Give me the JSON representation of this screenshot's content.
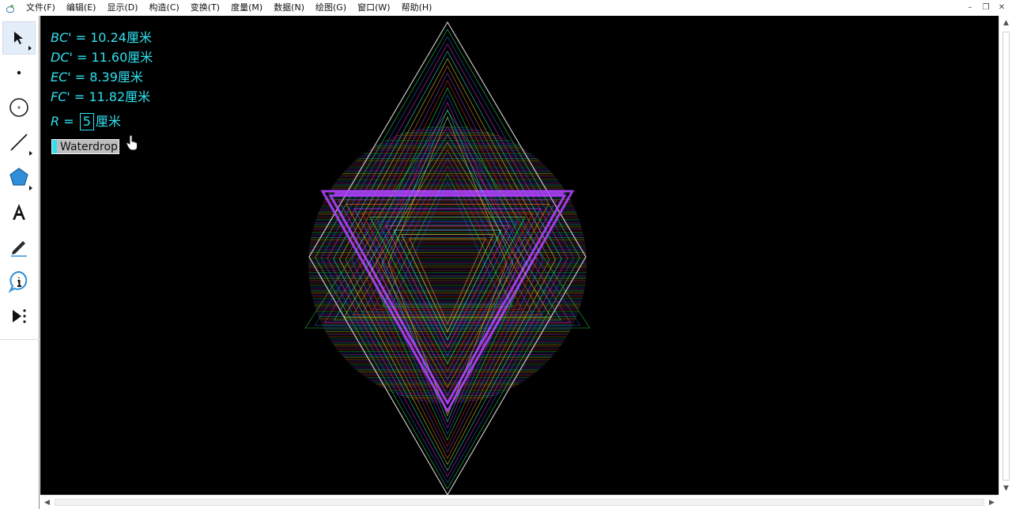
{
  "menu": {
    "items": [
      "文件(F)",
      "编辑(E)",
      "显示(D)",
      "构造(C)",
      "变换(T)",
      "度量(M)",
      "数据(N)",
      "绘图(G)",
      "窗口(W)",
      "帮助(H)"
    ]
  },
  "window_controls": {
    "minimize": "–",
    "restore": "❐",
    "close": "✕"
  },
  "toolbox": {
    "tools": [
      {
        "name": "arrow-select-tool",
        "glyph": "➤",
        "active": true
      },
      {
        "name": "point-tool",
        "glyph": "•"
      },
      {
        "name": "compass-tool",
        "glyph": "⊕"
      },
      {
        "name": "straightedge-tool",
        "glyph": "/"
      },
      {
        "name": "polygon-tool",
        "glyph": "⬟"
      },
      {
        "name": "text-tool",
        "glyph": "A"
      },
      {
        "name": "marker-tool",
        "glyph": "✎"
      },
      {
        "name": "information-tool",
        "glyph": "i"
      },
      {
        "name": "custom-tool",
        "glyph": "▶⋮"
      }
    ]
  },
  "measurements": [
    {
      "var": "BC'",
      "eq": " = 10.24",
      "unit": "厘米"
    },
    {
      "var": "DC'",
      "eq": " = 11.60",
      "unit": "厘米"
    },
    {
      "var": "EC'",
      "eq": " = 8.39",
      "unit": "厘米"
    },
    {
      "var": "FC'",
      "eq": " = 11.82",
      "unit": "厘米"
    }
  ],
  "parameter": {
    "var": "R",
    "eq": " = ",
    "value": "5",
    "unit": "厘米"
  },
  "action_button": {
    "label": "Waterdrop"
  },
  "colors": {
    "canvas_bg": "#000000",
    "measure_text": "#30e0f0",
    "button_cap": "#30e0f0",
    "button_bg": "#bdbdbd"
  }
}
